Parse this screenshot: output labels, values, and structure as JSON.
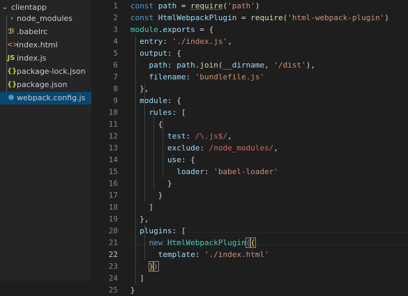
{
  "explorer": {
    "folder": "clientapp",
    "items": [
      {
        "label": "node_modules",
        "icon": "chevron-right-icon",
        "glyph": "›",
        "color": "#c5c5c5",
        "selected": false
      },
      {
        "label": ".babelrc",
        "icon": "babel-icon",
        "glyph": "ℬ",
        "color": "#e5c07b",
        "selected": false
      },
      {
        "label": "index.html",
        "icon": "html-icon",
        "glyph": "<>",
        "color": "#e37933",
        "selected": false
      },
      {
        "label": "index.js",
        "icon": "javascript-icon",
        "glyph": "JS",
        "color": "#cbcb41",
        "selected": false
      },
      {
        "label": "package-lock.json",
        "icon": "json-icon",
        "glyph": "{}",
        "color": "#cbcb41",
        "selected": false
      },
      {
        "label": "package.json",
        "icon": "json-icon",
        "glyph": "{}",
        "color": "#cbcb41",
        "selected": false
      },
      {
        "label": "webpack.config.js",
        "icon": "webpack-icon",
        "glyph": "⬢",
        "color": "#519aba",
        "selected": true
      }
    ]
  },
  "editor": {
    "active_line": 22,
    "lines": [
      [
        [
          "kw",
          "const "
        ],
        [
          "var",
          "path"
        ],
        [
          "p",
          " = "
        ],
        [
          "fn",
          "require"
        ],
        [
          "p",
          "("
        ],
        [
          "str",
          "'path'"
        ],
        [
          "p",
          ")"
        ]
      ],
      [
        [
          "kw",
          "const "
        ],
        [
          "var",
          "HtmlWebpackPlugin"
        ],
        [
          "p",
          " = "
        ],
        [
          "fn",
          "require"
        ],
        [
          "p",
          "("
        ],
        [
          "str",
          "'html-webpack-plugin'"
        ],
        [
          "p",
          ")"
        ]
      ],
      [
        [
          "cls",
          "module"
        ],
        [
          "p",
          "."
        ],
        [
          "var",
          "exports"
        ],
        [
          "p",
          " = {"
        ]
      ],
      [
        [
          "p",
          "  "
        ],
        [
          "var",
          "entry"
        ],
        [
          "p",
          ": "
        ],
        [
          "str",
          "'./index.js'"
        ],
        [
          "p",
          ","
        ]
      ],
      [
        [
          "p",
          "  "
        ],
        [
          "var",
          "output"
        ],
        [
          "p",
          ": {"
        ]
      ],
      [
        [
          "p",
          "    "
        ],
        [
          "var",
          "path"
        ],
        [
          "p",
          ": "
        ],
        [
          "var",
          "path"
        ],
        [
          "p",
          "."
        ],
        [
          "fn",
          "join"
        ],
        [
          "p",
          "("
        ],
        [
          "var",
          "__dirname"
        ],
        [
          "p",
          ", "
        ],
        [
          "str",
          "'/dist'"
        ],
        [
          "p",
          "),"
        ]
      ],
      [
        [
          "p",
          "    "
        ],
        [
          "var",
          "filename"
        ],
        [
          "p",
          ": "
        ],
        [
          "str",
          "'bundlefile.js'"
        ]
      ],
      [
        [
          "p",
          "  },"
        ]
      ],
      [
        [
          "p",
          "  "
        ],
        [
          "var",
          "module"
        ],
        [
          "p",
          ": {"
        ]
      ],
      [
        [
          "p",
          "    "
        ],
        [
          "var",
          "rules"
        ],
        [
          "p",
          ": ["
        ]
      ],
      [
        [
          "p",
          "      {"
        ]
      ],
      [
        [
          "p",
          "        "
        ],
        [
          "var",
          "test"
        ],
        [
          "p",
          ": "
        ],
        [
          "rx",
          "/\\.js$/"
        ],
        [
          "p",
          ","
        ]
      ],
      [
        [
          "p",
          "        "
        ],
        [
          "var",
          "exclude"
        ],
        [
          "p",
          ": "
        ],
        [
          "rx",
          "/node_modules/"
        ],
        [
          "p",
          ","
        ]
      ],
      [
        [
          "p",
          "        "
        ],
        [
          "var",
          "use"
        ],
        [
          "p",
          ": {"
        ]
      ],
      [
        [
          "p",
          "          "
        ],
        [
          "var",
          "loader"
        ],
        [
          "p",
          ": "
        ],
        [
          "str",
          "'babel-loader'"
        ]
      ],
      [
        [
          "p",
          "        }"
        ]
      ],
      [
        [
          "p",
          "      }"
        ]
      ],
      [
        [
          "p",
          "    ]"
        ]
      ],
      [
        [
          "p",
          "  },"
        ]
      ],
      [
        [
          "p",
          "  "
        ],
        [
          "var",
          "plugins"
        ],
        [
          "p",
          ": ["
        ]
      ],
      [
        [
          "p",
          "    "
        ],
        [
          "kw",
          "new "
        ],
        [
          "cls",
          "HtmlWebpackPlugin"
        ],
        [
          "br",
          "("
        ],
        [
          "br2",
          "{"
        ]
      ],
      [
        [
          "p",
          "      "
        ],
        [
          "var",
          "template"
        ],
        [
          "p",
          ": "
        ],
        [
          "str",
          "'./index.html'"
        ]
      ],
      [
        [
          "p",
          "    "
        ],
        [
          "br2",
          "}"
        ],
        [
          "br",
          ")"
        ]
      ],
      [
        [
          "p",
          "  ]"
        ]
      ],
      [
        [
          "p",
          "}"
        ]
      ]
    ]
  }
}
